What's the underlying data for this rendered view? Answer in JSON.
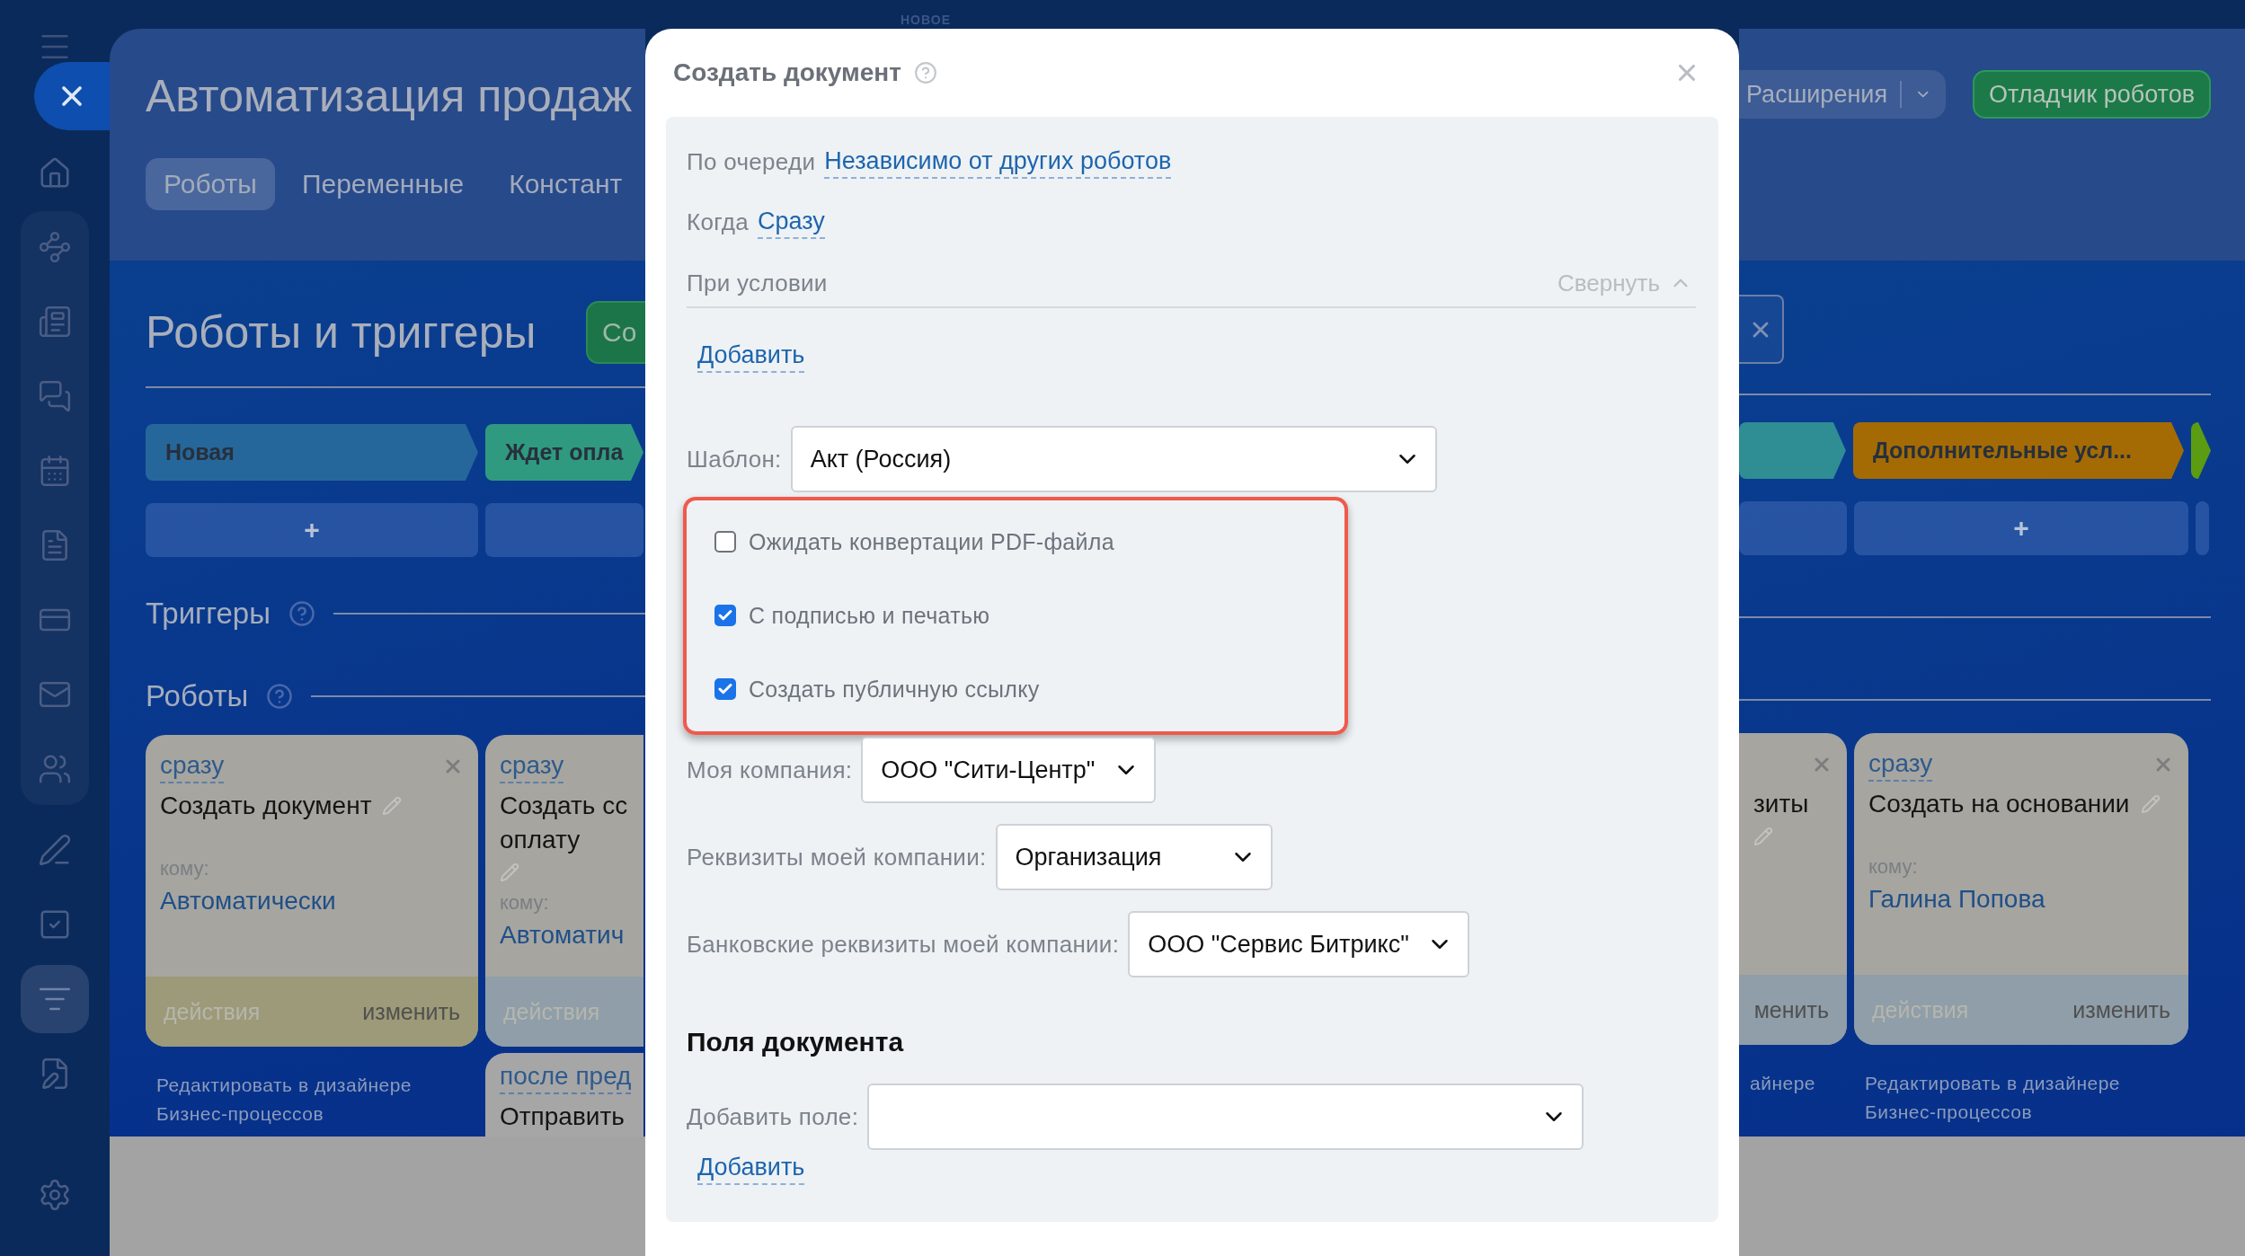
{
  "top_bar": {
    "tab_label": "НОВОЕ"
  },
  "sidebar": {
    "top_items": [
      {
        "selected": false
      }
    ],
    "group_items": [
      {
        "selected": false
      },
      {
        "selected": false
      },
      {
        "selected": false
      },
      {
        "selected": false
      },
      {
        "selected": false
      },
      {
        "selected": false
      },
      {
        "selected": false
      },
      {
        "selected": false
      }
    ],
    "lower_items": [
      {
        "selected": false
      },
      {
        "selected": false
      },
      {
        "selected": true
      },
      {
        "selected": false
      }
    ],
    "bottom_items": [
      {
        "selected": false
      }
    ]
  },
  "header": {
    "title": "Автоматизация продаж",
    "tabs": [
      {
        "label": "Роботы",
        "selected": true
      },
      {
        "label": "Переменные",
        "selected": false
      },
      {
        "label": "Констант",
        "selected": false
      }
    ],
    "extensions_button": "Расширения",
    "debugger_button": "Отладчик роботов"
  },
  "section": {
    "title": "Роботы и триггеры",
    "create_button": "Со",
    "triggers_label": "Триггеры",
    "robots_label": "Роботы"
  },
  "board_left": {
    "stages": [
      {
        "label": "Новая",
        "color": "#26679b",
        "add": "+"
      },
      {
        "label": "Ждет опла",
        "color": "#2f9a80"
      }
    ],
    "robot_columns": [
      [
        {
          "delay": "сразу",
          "title": "Создать документ",
          "to_label": "кому:",
          "assignee": "Автоматически",
          "actions": "действия",
          "edit": "изменить",
          "closable": true,
          "color": "#9c9a78",
          "designer_link": "Редактировать в дизайнере Бизнес-процессов"
        }
      ],
      [
        {
          "delay": "сразу",
          "title": "Создать сс оплату",
          "to_label": "кому:",
          "assignee": "Автоматич",
          "actions": "действия",
          "color": "#8f9ea8"
        },
        {
          "delay": "после пред",
          "title": "Отправить",
          "color": "#a6a6a6"
        }
      ]
    ]
  },
  "board_right": {
    "stages": [
      {
        "color": "#2f8d94"
      },
      {
        "label": "Дополнительные усл...",
        "color": "#a46b04",
        "add": "+"
      },
      {
        "color": "#5b9c12"
      }
    ],
    "robot_columns": [
      [
        {
          "title": "зиты",
          "edit": "менить",
          "closable": true,
          "color": "#8f9ea8",
          "designer_link": "айнере"
        }
      ],
      [
        {
          "delay": "сразу",
          "title": "Создать на основании",
          "to_label": "кому:",
          "assignee": "Галина Попова",
          "actions": "действия",
          "edit": "изменить",
          "closable": true,
          "color": "#8f9ea8",
          "designer_link": "Редактировать в дизайнере Бизнес-процессов"
        }
      ]
    ]
  },
  "dialog": {
    "title": "Создать документ",
    "order": {
      "label": "По очереди",
      "value": "Независимо от других роботов"
    },
    "when": {
      "label": "Когда",
      "value": "Сразу"
    },
    "condition": {
      "label": "При условии",
      "collapse": "Свернуть",
      "add": "Добавить"
    },
    "template": {
      "label": "Шаблон:",
      "value": "Акт (Россия)"
    },
    "options": [
      {
        "label": "Ожидать конвертации PDF-файла",
        "checked": false
      },
      {
        "label": "С подписью и печатью",
        "checked": true
      },
      {
        "label": "Создать публичную ссылку",
        "checked": true
      }
    ],
    "selects": [
      {
        "label": "Моя компания:",
        "value": "ООО \"Сити-Центр\""
      },
      {
        "label": "Реквизиты моей компании:",
        "value": "Организация"
      },
      {
        "label": "Банковские реквизиты моей компании:",
        "value": "ООО \"Сервис Битрикс\""
      }
    ],
    "document_fields": {
      "title": "Поля документа",
      "label": "Добавить поле:",
      "add": "Добавить"
    }
  }
}
